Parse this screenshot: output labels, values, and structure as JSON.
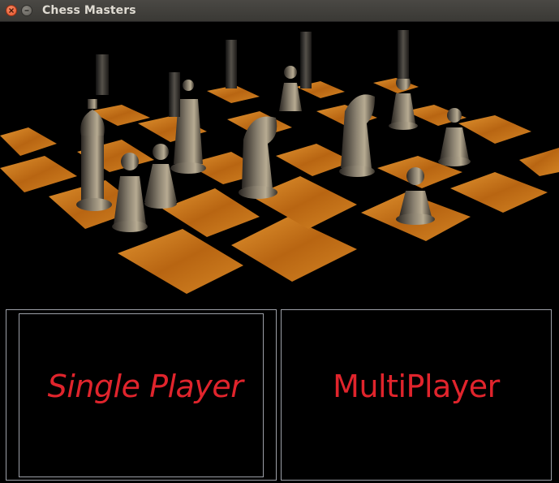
{
  "window": {
    "title": "Chess Masters",
    "controls": [
      "close-icon",
      "minimize-icon"
    ]
  },
  "banner": {
    "image": "chessboard-with-pieces",
    "colors": {
      "square_light": "#c8771c",
      "square_dark": "#050505",
      "piece": "#6d6558"
    }
  },
  "menu": {
    "single_player_label": "Single Player",
    "multiplayer_label": "MultiPlayer",
    "label_color": "#e0242c",
    "border_color": "#9da0a8"
  }
}
